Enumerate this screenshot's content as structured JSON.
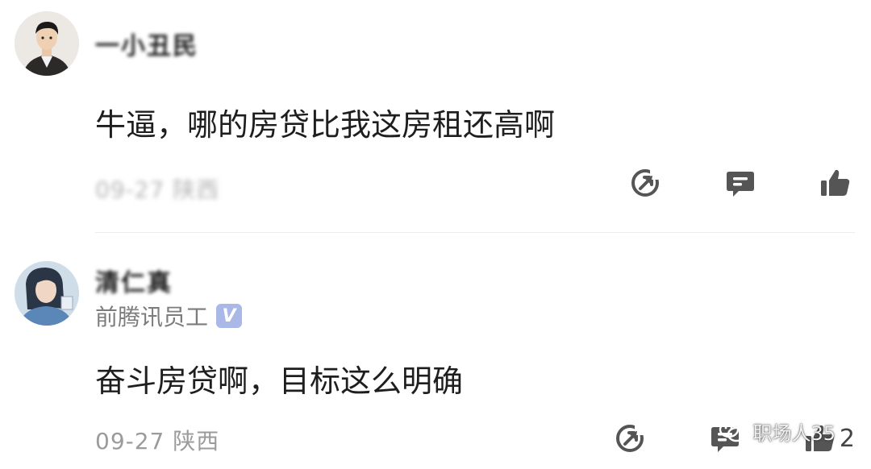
{
  "comments": [
    {
      "username": "一小丑民",
      "content": "牛逼，哪的房贷比我这房租还高啊",
      "meta": "09-27 陕西",
      "actions": {
        "share_icon": "share-icon",
        "reply_icon": "reply-icon",
        "like_icon": "thumbs-up-icon",
        "like_count": ""
      }
    },
    {
      "username": "清仁真",
      "badge": "前腾讯员工",
      "verified_mark": "V",
      "content": "奋斗房贷啊，目标这么明确",
      "meta": "09-27 陕西",
      "actions": {
        "share_icon": "share-icon",
        "reply_icon": "reply-icon",
        "like_icon": "thumbs-up-icon",
        "like_count": "2"
      }
    }
  ],
  "watermark": {
    "text": "职场人35",
    "icon": "wechat-icon"
  },
  "colors": {
    "text": "#1e1e1e",
    "meta": "#9b9b9b",
    "icon": "#555555",
    "verified": "#a9b8e6"
  }
}
